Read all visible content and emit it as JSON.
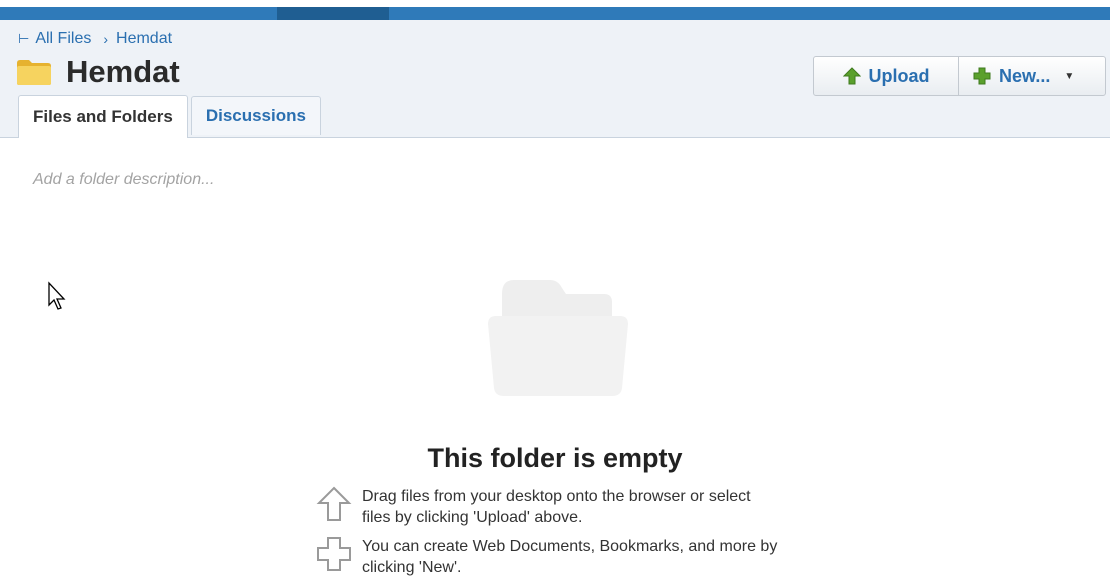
{
  "breadcrumb": {
    "root": "All Files",
    "separator": "›",
    "current": "Hemdat"
  },
  "header": {
    "title": "Hemdat"
  },
  "actions": {
    "upload_label": "Upload",
    "new_label": "New..."
  },
  "tabs": [
    {
      "label": "Files and Folders",
      "active": true
    },
    {
      "label": "Discussions",
      "active": false
    }
  ],
  "description_placeholder": "Add a folder description...",
  "empty_state": {
    "title": "This folder is empty",
    "hints": [
      {
        "icon": "upload-arrow-outline-icon",
        "text": "Drag files from your desktop onto the browser or select files by clicking 'Upload' above."
      },
      {
        "icon": "plus-outline-icon",
        "text": "You can create Web Documents, Bookmarks, and more by clicking 'New'."
      }
    ]
  },
  "colors": {
    "top_bar": "#2f7ab9",
    "link": "#2a6fb0",
    "upload_arrow": "#5aa02c",
    "new_plus": "#5aa02c",
    "folder": "#f3c94b"
  }
}
